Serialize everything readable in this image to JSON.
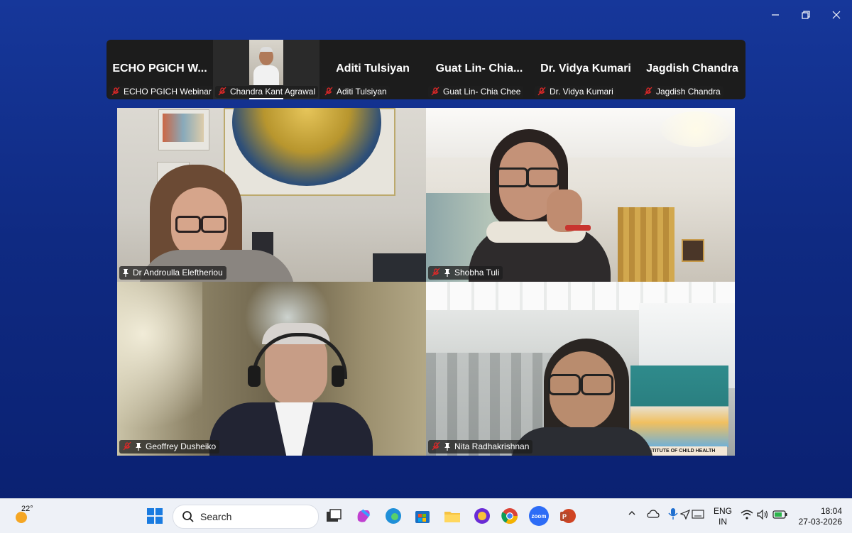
{
  "window_controls": {
    "minimize": "minimize-icon",
    "restore": "restore-icon",
    "close": "close-icon"
  },
  "strip": [
    {
      "big": "ECHO PGICH W...",
      "label": "ECHO PGICH Webinar ...",
      "has_video": false
    },
    {
      "big": "",
      "label": "Chandra Kant Agrawal",
      "has_video": true
    },
    {
      "big": "Aditi Tulsiyan",
      "label": "Aditi Tulsiyan",
      "has_video": false
    },
    {
      "big": "Guat Lin- Chia...",
      "label": "Guat Lin- Chia Chee",
      "has_video": false
    },
    {
      "big": "Dr. Vidya Kumari",
      "label": "Dr. Vidya Kumari",
      "has_video": false
    },
    {
      "big": "Jagdish Chandra",
      "label": "Jagdish Chandra",
      "has_video": false
    }
  ],
  "tiles": [
    {
      "name": "Dr Androulla Eleftheriou",
      "muted": false,
      "pinned": true,
      "active": true
    },
    {
      "name": "Shobha Tuli",
      "muted": true,
      "pinned": true,
      "active": false
    },
    {
      "name": "Geoffrey Dusheiko",
      "muted": true,
      "pinned": true,
      "active": false
    },
    {
      "name": "Nita Radhakrishnan",
      "muted": true,
      "pinned": true,
      "active": false
    }
  ],
  "tile_backdrop_text": "INSTITUTE OF CHILD HEALTH",
  "taskbar": {
    "weather": "22°",
    "search_placeholder": "Search",
    "apps": [
      "windows-start-icon",
      "task-view-icon",
      "copilot-icon",
      "edge-icon",
      "store-icon",
      "file-explorer-icon",
      "vpn-icon",
      "chrome-icon",
      "zoom-icon",
      "powerpoint-icon"
    ],
    "zoom_label": "zoom",
    "lang_top": "ENG",
    "lang_bottom": "IN",
    "time": "18:04",
    "date": "27-03-2026"
  },
  "colors": {
    "accent_active": "#3fd08a",
    "mute_red": "#e02828"
  }
}
